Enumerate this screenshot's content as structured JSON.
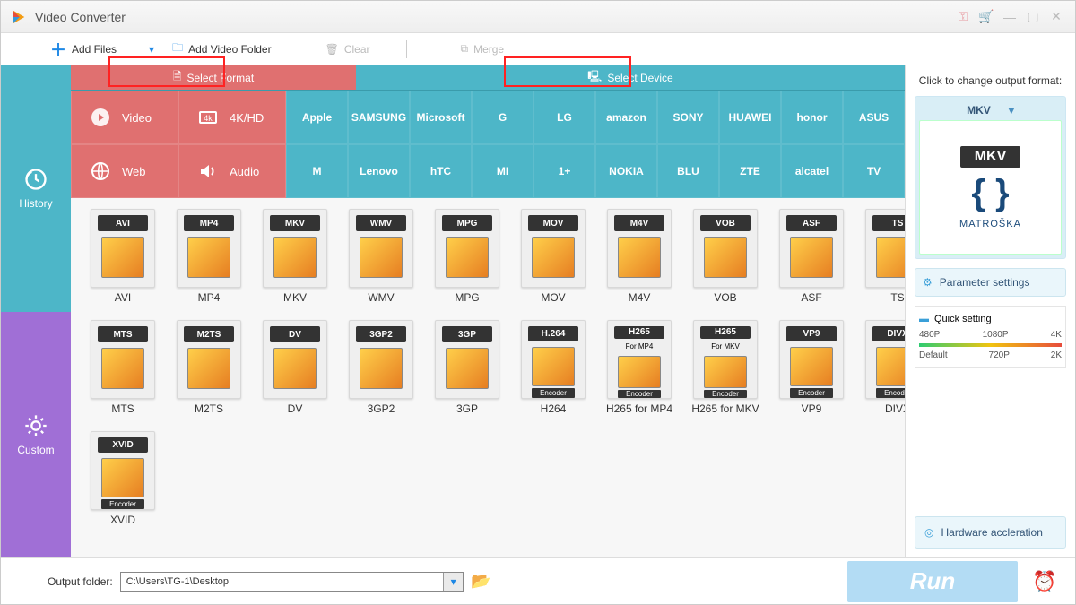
{
  "app": {
    "title": "Video Converter"
  },
  "toolbar": {
    "add_files": "Add Files",
    "add_folder": "Add Video Folder",
    "clear": "Clear",
    "merge": "Merge"
  },
  "tabs": {
    "select_format": "Select Format",
    "select_device": "Select Device"
  },
  "sidetabs": {
    "history": "History",
    "custom": "Custom"
  },
  "categories": {
    "video": "Video",
    "fourk": "4K/HD",
    "web": "Web",
    "audio": "Audio"
  },
  "brands_row1": [
    "Apple",
    "SAMSUNG",
    "Microsoft",
    "G",
    "LG",
    "amazon",
    "SONY",
    "HUAWEI",
    "honor",
    "ASUS"
  ],
  "brands_row2": [
    "M",
    "Lenovo",
    "hTC",
    "MI",
    "1+",
    "NOKIA",
    "BLU",
    "ZTE",
    "alcatel",
    "TV"
  ],
  "formats_row1": [
    {
      "hdr": "AVI",
      "label": "AVI"
    },
    {
      "hdr": "MP4",
      "label": "MP4"
    },
    {
      "hdr": "MKV",
      "label": "MKV"
    },
    {
      "hdr": "WMV",
      "label": "WMV"
    },
    {
      "hdr": "MPG",
      "label": "MPG"
    },
    {
      "hdr": "MOV",
      "label": "MOV"
    },
    {
      "hdr": "M4V",
      "label": "M4V"
    },
    {
      "hdr": "VOB",
      "label": "VOB"
    },
    {
      "hdr": "ASF",
      "label": "ASF"
    },
    {
      "hdr": "TS",
      "label": "TS"
    }
  ],
  "formats_row2": [
    {
      "hdr": "MTS",
      "label": "MTS"
    },
    {
      "hdr": "M2TS",
      "label": "M2TS"
    },
    {
      "hdr": "DV",
      "label": "DV"
    },
    {
      "hdr": "3GP2",
      "label": "3GP2"
    },
    {
      "hdr": "3GP",
      "label": "3GP"
    },
    {
      "hdr": "H.264",
      "label": "H264",
      "sub": "Encoder"
    },
    {
      "hdr": "H265",
      "label": "H265 for MP4",
      "sub": "Encoder",
      "mid": "For MP4"
    },
    {
      "hdr": "H265",
      "label": "H265 for MKV",
      "sub": "Encoder",
      "mid": "For MKV"
    },
    {
      "hdr": "VP9",
      "label": "VP9",
      "sub": "Encoder"
    },
    {
      "hdr": "DIVX",
      "label": "DIVX",
      "sub": "Encoder"
    }
  ],
  "formats_row3": [
    {
      "hdr": "XVID",
      "label": "XVID",
      "sub": "Encoder"
    }
  ],
  "right": {
    "hint": "Click to change output format:",
    "selected": "MKV",
    "box_brand": "MKV",
    "box_sub": "MATROŠKA",
    "param": "Parameter settings",
    "quick": "Quick setting",
    "qs_top": [
      "480P",
      "1080P",
      "4K"
    ],
    "qs_bottom": [
      "Default",
      "720P",
      "2K"
    ],
    "hw": "Hardware accleration"
  },
  "footer": {
    "label": "Output folder:",
    "path": "C:\\Users\\TG-1\\Desktop",
    "run": "Run"
  }
}
